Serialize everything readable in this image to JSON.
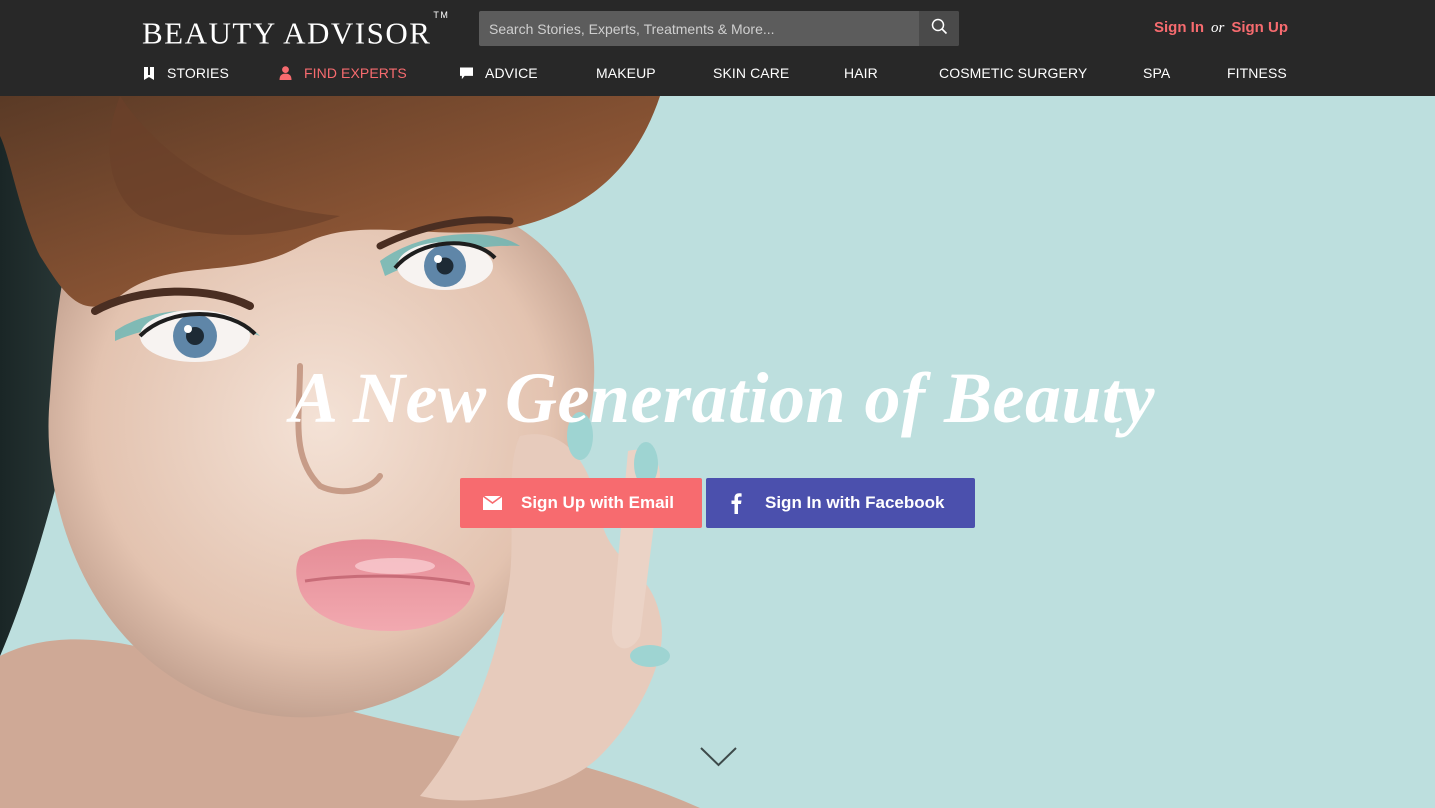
{
  "header": {
    "logo_text": "BEAUTY ADVISOR",
    "logo_tm": "TM",
    "search": {
      "placeholder": "Search Stories, Experts, Treatments & More..."
    },
    "sign_in": "Sign In",
    "or": "or",
    "sign_up": "Sign Up"
  },
  "nav": [
    {
      "label": "STORIES",
      "icon": "book-icon"
    },
    {
      "label": "FIND EXPERTS",
      "icon": "person-icon",
      "active": true
    },
    {
      "label": "ADVICE",
      "icon": "speech-bubble-icon"
    },
    {
      "label": "MAKEUP"
    },
    {
      "label": "SKIN CARE"
    },
    {
      "label": "HAIR"
    },
    {
      "label": "COSMETIC SURGERY"
    },
    {
      "label": "SPA"
    },
    {
      "label": "FITNESS"
    }
  ],
  "hero": {
    "title": "A New Generation of Beauty",
    "email_button": "Sign Up with Email",
    "facebook_button": "Sign In with Facebook"
  },
  "colors": {
    "header_bg": "#282828",
    "accent": "#f76b6f",
    "facebook": "#4b50ad",
    "hero_bg": "#bddfde"
  }
}
